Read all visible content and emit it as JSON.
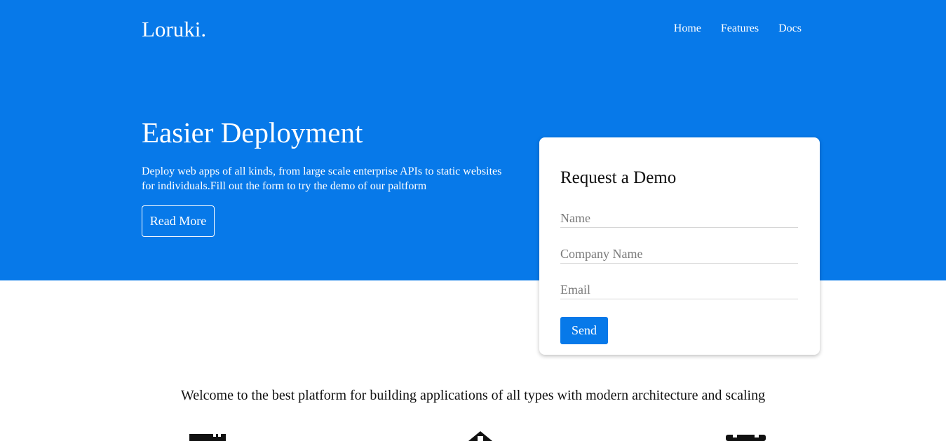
{
  "brand": {
    "logo": "Loruki."
  },
  "nav": {
    "items": [
      "Home",
      "Features",
      "Docs"
    ]
  },
  "hero": {
    "title": "Easier Deployment",
    "text": "Deploy web apps of all kinds, from large scale enterprise APIs to static websites for individuals.Fill out the form to try the demo of our paltform",
    "button_label": "Read More",
    "background_color": "#0779e9"
  },
  "demo_form": {
    "title": "Request a Demo",
    "name_placeholder": "Name",
    "company_placeholder": "Company Name",
    "email_placeholder": "Email",
    "name_value": "",
    "company_value": "",
    "email_value": "",
    "submit_label": "Send"
  },
  "features": {
    "intro": "Welcome to the best platform for building applications of all types with modern architecture and scaling",
    "icons": [
      "server-icon",
      "home-icon",
      "calendar-icon"
    ]
  }
}
